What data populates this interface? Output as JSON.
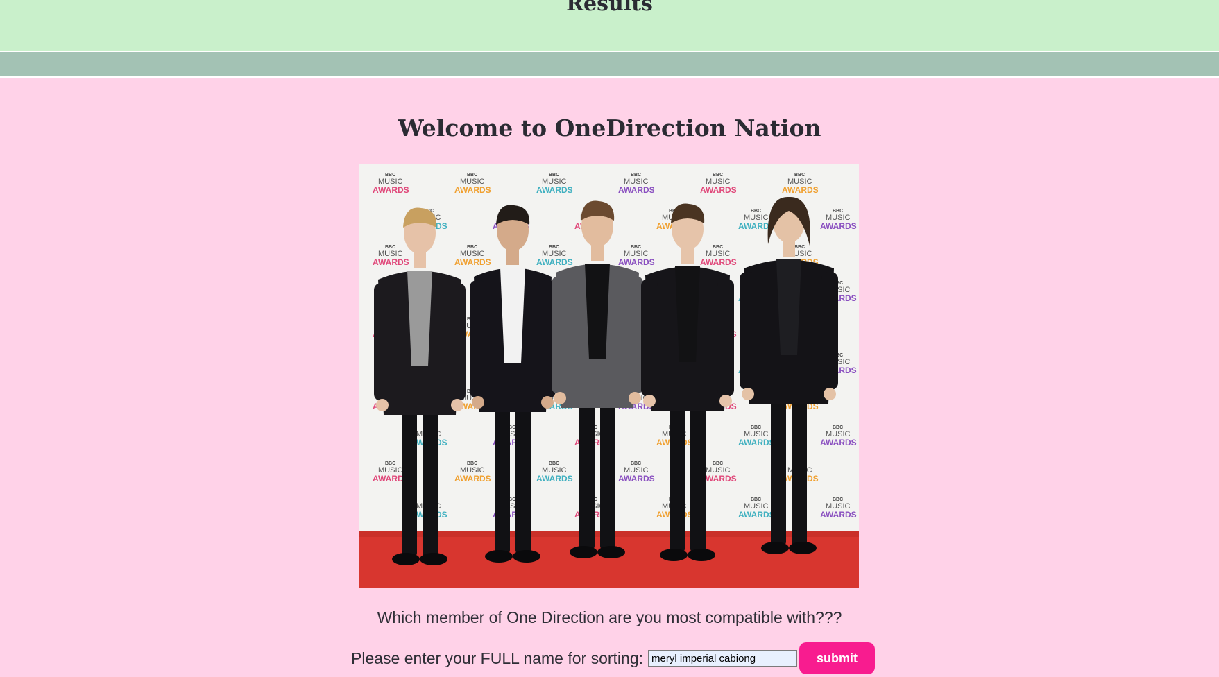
{
  "header": {
    "title": "Results",
    "bg_color": "#c9f0cb"
  },
  "nav_strip": {
    "bg_color": "#a3c2b4"
  },
  "main": {
    "bg_color": "#ffd2e8",
    "heading": "Welcome to OneDirection Nation",
    "photo": {
      "backdrop_text": [
        "BBC",
        "MUSIC",
        "AWARDS"
      ]
    },
    "question": "Which member of One Direction are you most compatible with???",
    "form": {
      "label": "Please enter your FULL name for sorting:",
      "name_value": "meryl imperial cabiong",
      "submit_label": "submit",
      "submit_color": "#f81c8f"
    }
  }
}
